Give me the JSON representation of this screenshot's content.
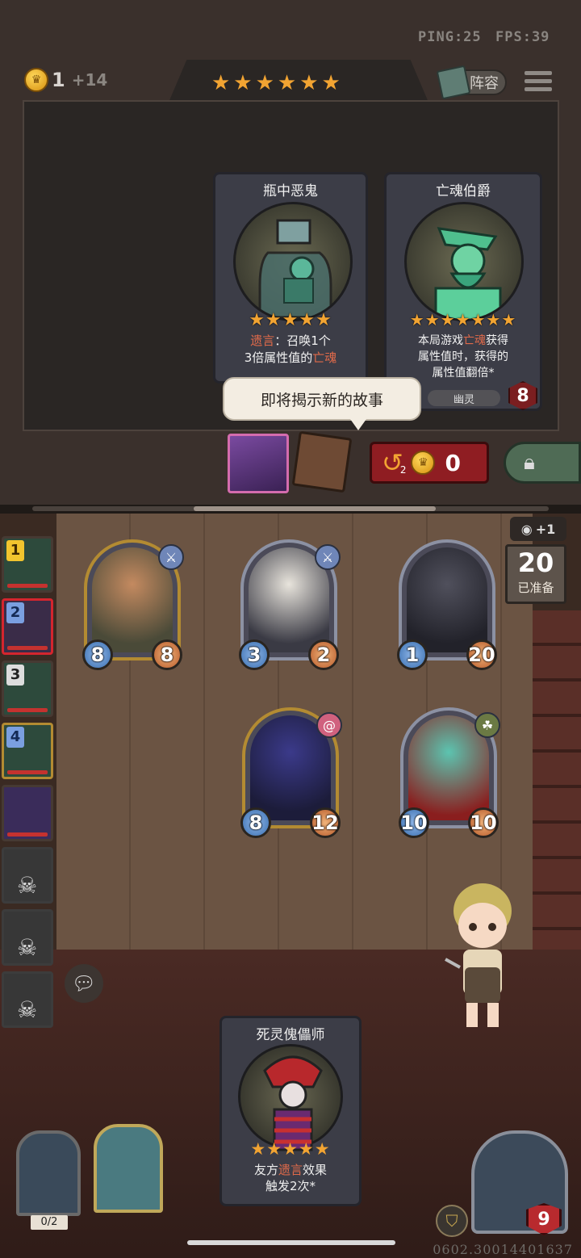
{
  "status": {
    "ping": "PING:25",
    "fps": "FPS:39"
  },
  "economy": {
    "gold": "1",
    "income": "+14",
    "refresh_count": "2",
    "refresh_cost": "0"
  },
  "tavern": {
    "stars": "★★★★★★"
  },
  "lineup_label": "阵容",
  "shop_cards": [
    {
      "name": "瓶中恶鬼",
      "stars": "★★★★★",
      "desc_a": "遗言",
      "desc_b": "：召唤1个",
      "desc_c": "3倍属性值的",
      "desc_d": "亡魂"
    },
    {
      "name": "亡魂伯爵",
      "stars": "★★★★★★★",
      "desc_a": "本局游戏",
      "desc_b": "亡魂",
      "desc_c": "获得",
      "desc_d": "属性值时，获得的",
      "desc_e": "属性值翻倍*",
      "tag": "幽灵",
      "tier": "8"
    }
  ],
  "tooltip": "即将揭示新的故事",
  "board": {
    "prep_count": "20",
    "prep_label": "已准备",
    "vision_bonus": "+1",
    "minions": [
      {
        "atk": "8",
        "hp": "8"
      },
      {
        "atk": "3",
        "hp": "2"
      },
      {
        "atk": "1",
        "hp": "20"
      },
      {
        "atk": "8",
        "hp": "12"
      },
      {
        "atk": "10",
        "hp": "10"
      }
    ]
  },
  "roster": [
    "1",
    "2",
    "3",
    "4"
  ],
  "hand_card": {
    "name": "死灵傀儡师",
    "stars": "★★★★★",
    "desc_a": "友方",
    "desc_b": "遗言",
    "desc_c": "效果",
    "desc_d": "触发2次*"
  },
  "treasure_count": "0/2",
  "hero_hp": "9",
  "build_id": "0602.30014401637",
  "icons": {
    "coin": "crown-coin-icon",
    "menu": "hamburger-icon",
    "refresh": "refresh-arrow-icon",
    "lock": "lock-icon",
    "chat": "chat-bubble-icon",
    "eye": "eye-icon",
    "skull": "skull-icon"
  }
}
